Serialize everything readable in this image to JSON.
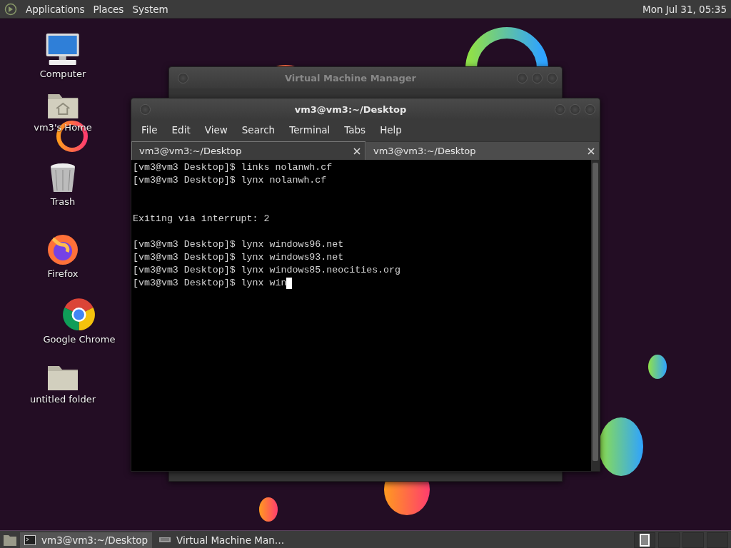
{
  "top_panel": {
    "menus": [
      "Applications",
      "Places",
      "System"
    ],
    "clock": "Mon Jul 31, 05:35"
  },
  "desktop_icons": [
    {
      "label": "Computer",
      "kind": "computer"
    },
    {
      "label": "vm3's Home",
      "kind": "home"
    },
    {
      "label": "Trash",
      "kind": "trash"
    },
    {
      "label": "Firefox",
      "kind": "firefox"
    },
    {
      "label": "Google Chrome",
      "kind": "chrome"
    },
    {
      "label": "untitled folder",
      "kind": "folder"
    }
  ],
  "back_window": {
    "title": "Virtual Machine Manager"
  },
  "terminal": {
    "title": "vm3@vm3:~/Desktop",
    "menu": [
      "File",
      "Edit",
      "View",
      "Search",
      "Terminal",
      "Tabs",
      "Help"
    ],
    "tabs": [
      {
        "label": "vm3@vm3:~/Desktop",
        "selected": true
      },
      {
        "label": "vm3@vm3:~/Desktop",
        "selected": false
      }
    ],
    "lines": [
      {
        "kind": "text",
        "text": "[vm3@vm3 Desktop]$ links nolanwh.cf"
      },
      {
        "kind": "text",
        "text": "[vm3@vm3 Desktop]$ lynx nolanwh.cf"
      },
      {
        "kind": "blank"
      },
      {
        "kind": "blank"
      },
      {
        "kind": "text",
        "text": "Exiting via interrupt: 2"
      },
      {
        "kind": "blank"
      },
      {
        "kind": "text",
        "text": "[vm3@vm3 Desktop]$ lynx windows96.net"
      },
      {
        "kind": "text",
        "text": "[vm3@vm3 Desktop]$ lynx windows93.net"
      },
      {
        "kind": "text",
        "text": "[vm3@vm3 Desktop]$ lynx windows85.neocities.org"
      },
      {
        "kind": "text",
        "text": "[vm3@vm3 Desktop]$ lynx win"
      }
    ],
    "cursor": true
  },
  "taskbar": {
    "tasks": [
      {
        "label": "vm3@vm3:~/Desktop",
        "kind": "terminal",
        "selected": true
      },
      {
        "label": "Virtual Machine Man…",
        "kind": "vmm",
        "selected": false
      }
    ],
    "workspaces": [
      {
        "selected": true
      },
      {
        "selected": false
      },
      {
        "selected": false
      },
      {
        "selected": false
      }
    ]
  }
}
